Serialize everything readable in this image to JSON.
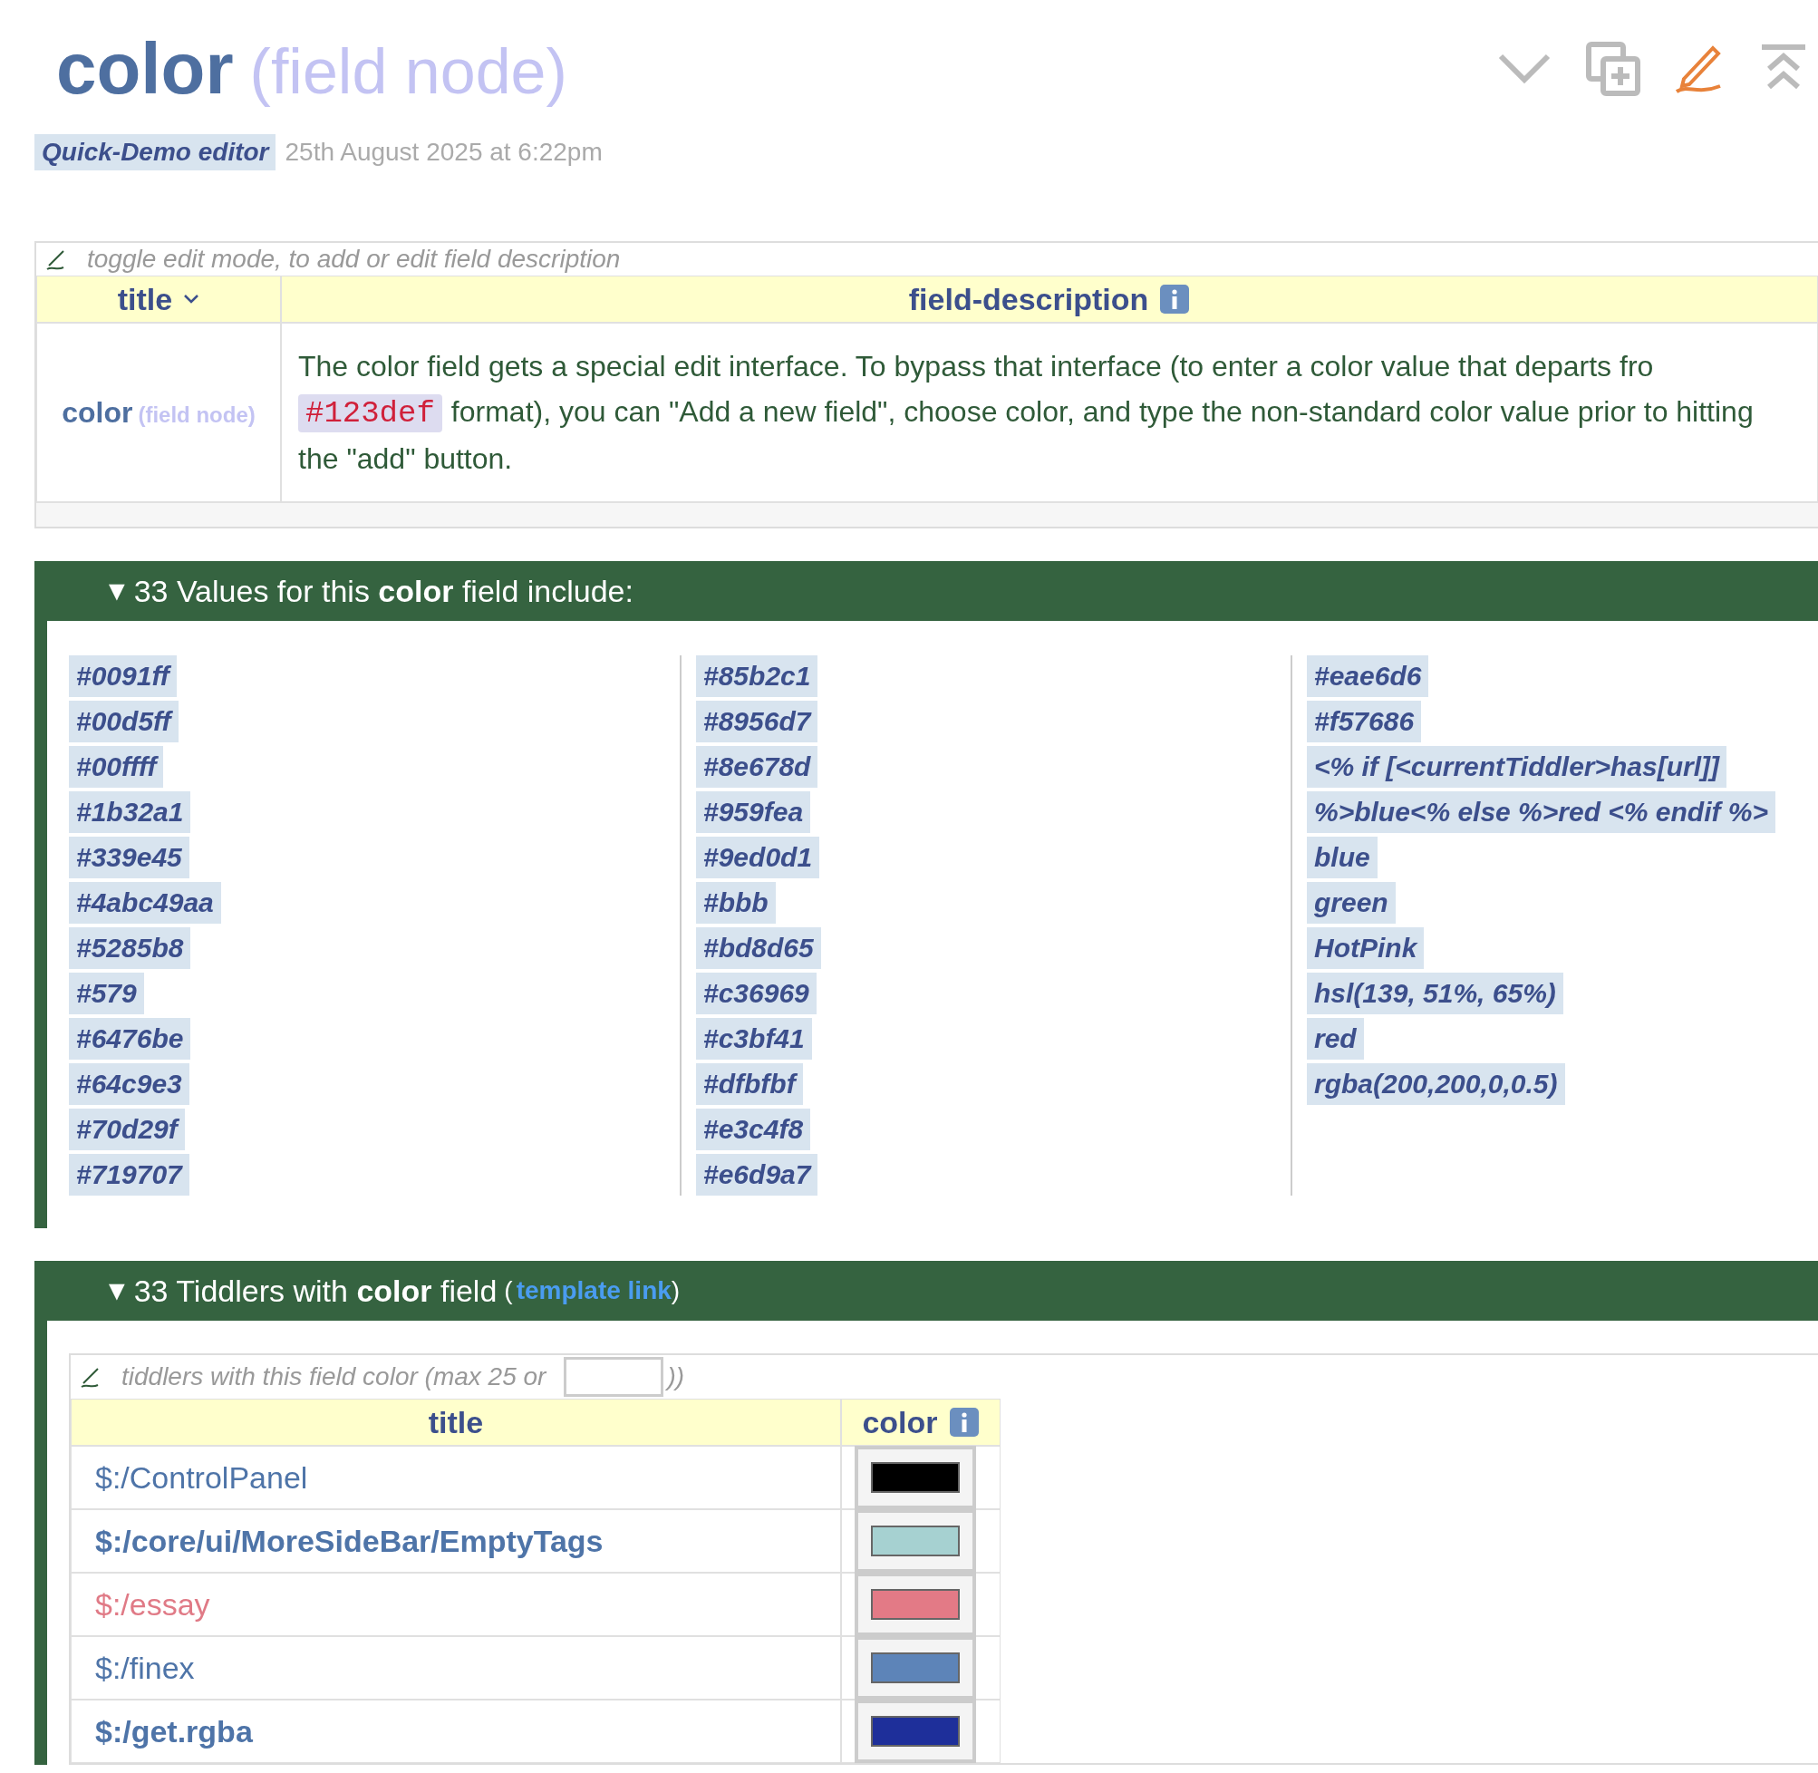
{
  "header": {
    "title": "color",
    "subtitle": "(field node)",
    "modifier": "Quick-Demo editor",
    "modified": "25th August 2025 at 6:22pm"
  },
  "description_table": {
    "edit_hint": "toggle edit mode, to add or edit field description",
    "columns": [
      {
        "label": "title",
        "sortable": true
      },
      {
        "label": "field-description",
        "sortable": false
      }
    ],
    "row": {
      "title": "color",
      "subtitle": "(field node)",
      "text_before": "The color field gets a special edit interface. To bypass that interface (to enter a color value that departs fro",
      "code": "#123def",
      "text_after": "format), you can \"Add a new field\", choose color, and type the non-standard color value prior to hitting the \"add\" button."
    }
  },
  "values_section": {
    "toggle": "▼",
    "heading": "33 Values for this **color** field include:",
    "expanded": true,
    "columns": [
      [
        "#0091ff",
        "#00d5ff",
        "#00ffff",
        "#1b32a1",
        "#339e45",
        "#4abc49aa",
        "#5285b8",
        "#579",
        "#6476be",
        "#64c9e3",
        "#70d29f",
        "#719707"
      ],
      [
        "#85b2c1",
        "#8956d7",
        "#8e678d",
        "#959fea",
        "#9ed0d1",
        "#bbb",
        "#bd8d65",
        "#c36969",
        "#c3bf41",
        "#dfbfbf",
        "#e3c4f8",
        "#e6d9a7"
      ],
      [
        "#eae6d6",
        "#f57686",
        "<% if [<currentTiddler>has[url]]",
        "%>blue<% else %>red <% endif %>",
        "blue",
        "green",
        "HotPink",
        "hsl(139, 51%, 65%)",
        "red",
        "rgba(200,200,0,0.5)"
      ]
    ]
  },
  "tiddlers_section": {
    "toggle": "▼",
    "heading": "33 Tiddlers with **color** field",
    "open_paren": "(",
    "link": "template link",
    "close_paren": ")",
    "expanded": true,
    "edit_hint": "tiddlers with this field color (max 25 or",
    "edit_hint_end": "))",
    "columns": [
      "title",
      "color"
    ],
    "rows": [
      {
        "title": "$:/ControlPanel",
        "kind": "plain",
        "bold": false,
        "color": "#000000"
      },
      {
        "title": "$:/core/ui/MoreSideBar/EmptyTags",
        "kind": "plain",
        "bold": true,
        "color": "#a6d1d1"
      },
      {
        "title": "$:/essay",
        "kind": "accent",
        "bold": false,
        "color": "#e37a86"
      },
      {
        "title": "$:/finex",
        "kind": "plain",
        "bold": false,
        "color": "#5d84b8"
      },
      {
        "title": "$:/get.rgba",
        "kind": "plain",
        "bold": true,
        "color": "#1e2f9a"
      }
    ]
  }
}
